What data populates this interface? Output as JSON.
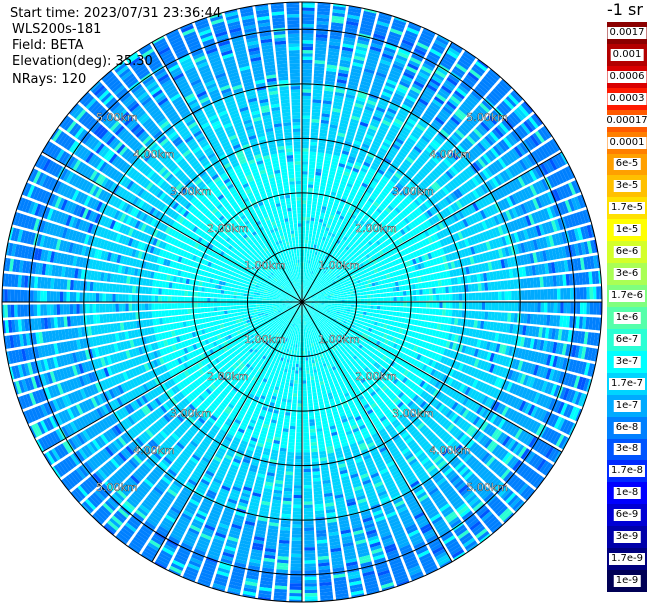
{
  "header": {
    "start_time": "Start time: 2023/07/31 23:36:44",
    "instrument": "WLS200s-181",
    "field": "Field: BETA",
    "elevation": "Elevation(deg): 35.30",
    "nrays": "NRays: 120"
  },
  "colorbar": {
    "unit_label": "-1 sr",
    "levels": [
      {
        "label": "0.0017",
        "color": "#8b0000"
      },
      {
        "label": "0.001",
        "color": "#b30000"
      },
      {
        "label": "0.0006",
        "color": "#d90000"
      },
      {
        "label": "0.0003",
        "color": "#ff1a00"
      },
      {
        "label": "0.00017",
        "color": "#ff5a00"
      },
      {
        "label": "0.0001",
        "color": "#ff7f00"
      },
      {
        "label": "6e-5",
        "color": "#ffa000"
      },
      {
        "label": "3e-5",
        "color": "#ffc000"
      },
      {
        "label": "1.7e-5",
        "color": "#ffe000"
      },
      {
        "label": "1e-5",
        "color": "#ffff00"
      },
      {
        "label": "6e-6",
        "color": "#d4ff2a"
      },
      {
        "label": "3e-6",
        "color": "#aaff55"
      },
      {
        "label": "1.7e-6",
        "color": "#7fff7f"
      },
      {
        "label": "1e-6",
        "color": "#55ffaa"
      },
      {
        "label": "6e-7",
        "color": "#2affd4"
      },
      {
        "label": "3e-7",
        "color": "#00ffff"
      },
      {
        "label": "1.7e-7",
        "color": "#00d4ff"
      },
      {
        "label": "1e-7",
        "color": "#00aaff"
      },
      {
        "label": "6e-8",
        "color": "#0080ff"
      },
      {
        "label": "3e-8",
        "color": "#0055ff"
      },
      {
        "label": "1.7e-8",
        "color": "#002aff"
      },
      {
        "label": "1e-8",
        "color": "#0000ff"
      },
      {
        "label": "6e-9",
        "color": "#0000d4"
      },
      {
        "label": "3e-9",
        "color": "#0000aa"
      },
      {
        "label": "1.7e-9",
        "color": "#00007f"
      },
      {
        "label": "1e-9",
        "color": "#000055"
      }
    ]
  },
  "chart_data": {
    "type": "heatmap",
    "projection": "polar-ppi",
    "field": "BETA",
    "n_rays": 120,
    "elevation_deg": 35.3,
    "range_km": [
      0,
      5.5
    ],
    "range_ring_labels_km": [
      "1.00km",
      "2.00km",
      "3.00km",
      "4.00km",
      "5.00km"
    ],
    "range_ring_values_km": [
      1,
      2,
      3,
      4,
      5
    ],
    "radial_spokes_deg": [
      0,
      30,
      60,
      90,
      120,
      150,
      180,
      210,
      240,
      270,
      300,
      330
    ],
    "typical_value_by_range": [
      {
        "range_km": 0.5,
        "value": "3e-7"
      },
      {
        "range_km": 2.0,
        "value": "3e-7"
      },
      {
        "range_km": 3.5,
        "value": "1.7e-7"
      },
      {
        "range_km": 4.5,
        "value": "1e-7"
      },
      {
        "range_km": 5.3,
        "value": "6e-8"
      }
    ],
    "grid": true
  }
}
